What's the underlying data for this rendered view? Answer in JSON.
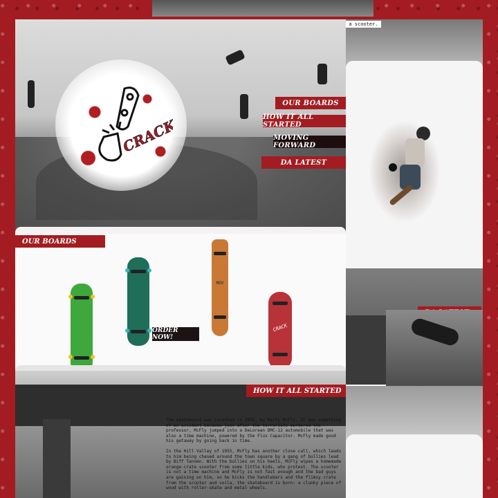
{
  "colors": {
    "brand_red": "#a31c22",
    "dark": "#1d0d0e",
    "paper": "#f4f2f2"
  },
  "hero": {
    "logo_text": "CRACK",
    "nav": [
      {
        "label": "OUR BOARDS",
        "style": "red"
      },
      {
        "label": "HOW IT ALL STARTED",
        "style": "red"
      },
      {
        "label": "MOVING FORWARD",
        "style": "dark"
      },
      {
        "label": "DA LATEST",
        "style": "red"
      }
    ]
  },
  "boards": {
    "section_label": "OUR BOARDS",
    "order_label": "ORDER NOW!",
    "items": [
      {
        "name": "green-board",
        "deck": "#3fa83c",
        "wheel": "#f1c21b"
      },
      {
        "name": "teal-board",
        "deck": "#1f6e5a",
        "wheel": "#3ab6c4"
      },
      {
        "name": "orange-cruiser",
        "deck": "#c97935",
        "wheel": "#eee",
        "text": "MOV"
      },
      {
        "name": "red-cruiser",
        "deck": "#b8323a",
        "wheel": "#f0f0f0",
        "text": "CRACK"
      }
    ]
  },
  "story": {
    "section_label": "HOW IT ALL STARTED",
    "paragraphs": [
      "The skateboard was invented in 1955, by Marty McFly. It was something of an accident because just after the terrorists murdered the professor, McFly jumped into a DeLorean DMC-12 automobile that was also a time machine, powered by the Flux Capacitor. McFly made good his getaway by going back in time.",
      "In the Hill Valley of 1955, McFly has another close call, which leads to him being chased around the town square by a gang of bullies lead by Biff Tannen. With the bullies on his heels, McFly wipes a homemade orange-crate scooter from some little kids, who protest. The scooter is not a time machine and McFly is not fast enough and the bad guys are gaining on him, so he kicks the handlebars and the flimsy crate from the scooter and voila, the skateboard is born: a clunky piece of wood with roller-skate and metal wheels."
    ]
  },
  "right_page": {
    "caption": "m a scooter.",
    "latest_label": "DA LATEST"
  }
}
